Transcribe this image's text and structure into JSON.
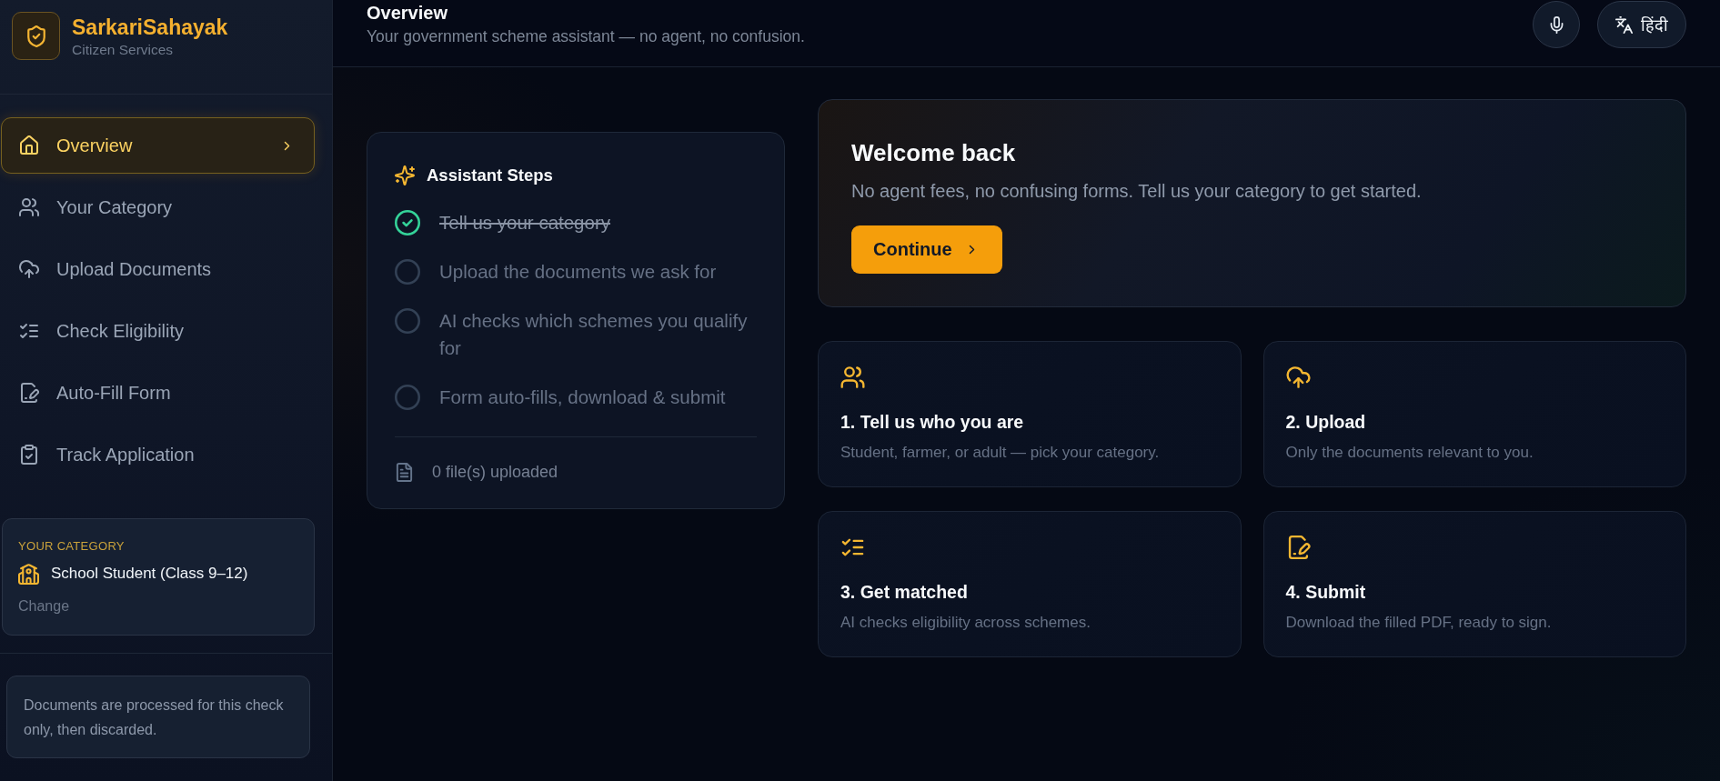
{
  "sidebar": {
    "brand_name": "SarkariSahayak",
    "brand_tagline": "Citizen Services",
    "nav_items": [
      {
        "label": "Overview",
        "selected": true
      },
      {
        "label": "Your Category",
        "selected": false
      },
      {
        "label": "Upload Documents",
        "selected": false
      },
      {
        "label": "Check Eligibility",
        "selected": false
      },
      {
        "label": "Auto-Fill Form",
        "selected": false
      },
      {
        "label": "Track Application",
        "selected": false
      }
    ],
    "category_card": {
      "heading": "YOUR CATEGORY",
      "value": "School Student (Class 9–12)",
      "action": "Change"
    },
    "privacy_note": "Documents are processed for this check only, then discarded."
  },
  "header": {
    "title": "Overview",
    "subtitle": "Your government scheme assistant — no agent, no confusion.",
    "language_button": "हिंदी"
  },
  "steps_card": {
    "title": "Assistant Steps",
    "steps": [
      {
        "label": "Tell us your category",
        "done": true
      },
      {
        "label": "Upload the documents we ask for",
        "done": false
      },
      {
        "label": "AI checks which schemes you qualify for",
        "done": false
      },
      {
        "label": "Form auto-fills, download & submit",
        "done": false
      }
    ],
    "files_status": "0 file(s) uploaded"
  },
  "welcome_card": {
    "title": "Welcome back",
    "text": "No agent fees, no confusing forms. Tell us your category to get started.",
    "button": "Continue"
  },
  "feature_cards": [
    {
      "title": "1. Tell us who you are",
      "text": "Student, farmer, or adult — pick your category."
    },
    {
      "title": "2. Upload",
      "text": "Only the documents relevant to you."
    },
    {
      "title": "3. Get matched",
      "text": "AI checks eligibility across schemes."
    },
    {
      "title": "4. Submit",
      "text": "Download the filled PDF, ready to sign."
    }
  ]
}
